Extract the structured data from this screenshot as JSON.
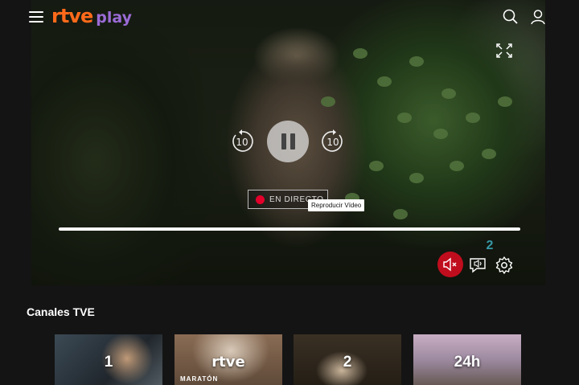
{
  "brand": {
    "name_part1": "rtve",
    "name_part2": "play"
  },
  "header": {
    "menu_icon": "hamburger-icon",
    "search_icon": "search-icon",
    "user_icon": "user-icon"
  },
  "player": {
    "live_label": "EN DIRECTO",
    "tooltip": "Reproducir Vídeo",
    "rewind_seconds": "10",
    "forward_seconds": "10",
    "channel_badge": "2",
    "progress": 1.0,
    "muted": true,
    "colors": {
      "live": "#e4002b",
      "mute": "#c00d1e"
    }
  },
  "channels": {
    "title": "Canales TVE",
    "items": [
      {
        "label": "1",
        "subtitle": ""
      },
      {
        "label": "rtve",
        "subtitle": "MARATÓN"
      },
      {
        "label": "2",
        "subtitle": ""
      },
      {
        "label": "24h",
        "subtitle": ""
      }
    ]
  }
}
